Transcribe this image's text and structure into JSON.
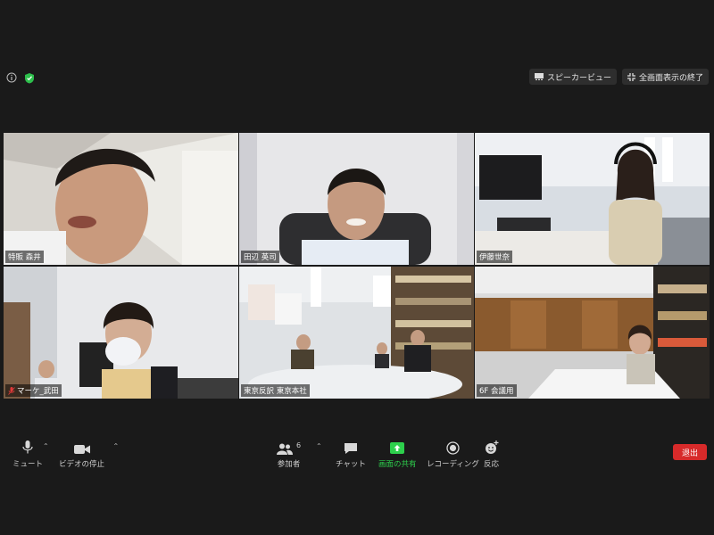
{
  "top_right": {
    "speaker_view": "スピーカービュー",
    "exit_fullscreen": "全画面表示の終了"
  },
  "participants": [
    {
      "name": "特販 森井",
      "active": true
    },
    {
      "name": "田辺 英司",
      "active": false
    },
    {
      "name": "伊藤世奈",
      "active": false
    },
    {
      "name": "マーケ_武田",
      "active": false,
      "muted": true
    },
    {
      "name": "東京反訳 東京本社",
      "active": false
    },
    {
      "name": "6F 会議用",
      "active": false
    }
  ],
  "toolbar": {
    "mute": "ミュート",
    "stop_video": "ビデオの停止",
    "participants_label": "参加者",
    "participants_count": "6",
    "chat": "チャット",
    "share_screen": "画面の共有",
    "record": "レコーディング",
    "reactions": "反応",
    "leave": "退出"
  },
  "colors": {
    "background": "#1a1a1a",
    "active_speaker": "#e6e84a",
    "share_green": "#2dcf4c",
    "leave_red": "#d72a2a"
  }
}
